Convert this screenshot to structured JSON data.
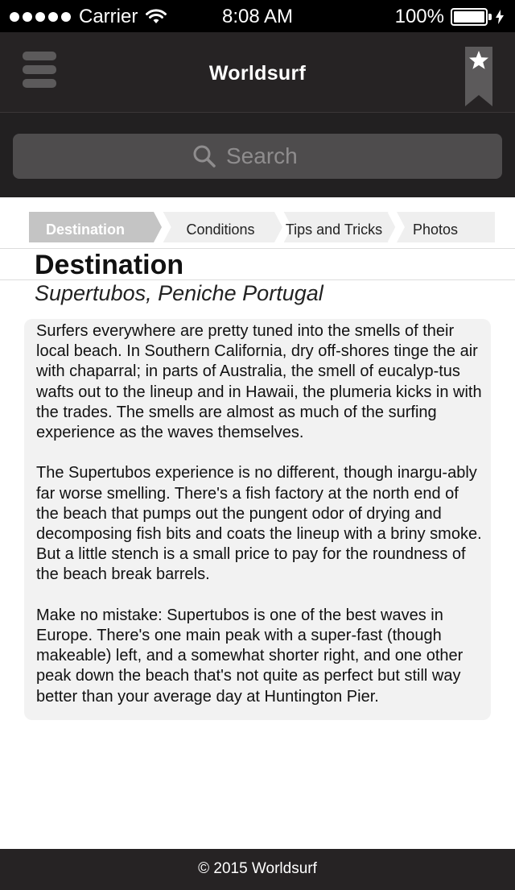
{
  "status_bar": {
    "carrier": "Carrier",
    "time": "8:08 AM",
    "battery": "100%",
    "signal_icon": "signal-dots-icon",
    "wifi_icon": "wifi-icon",
    "battery_icon": "battery-icon",
    "charging_icon": "charging-bolt-icon"
  },
  "header": {
    "title": "Worldsurf",
    "menu_icon": "hamburger-menu-icon",
    "bookmark_icon": "bookmark-star-icon"
  },
  "search": {
    "placeholder": "Search",
    "icon": "search-icon"
  },
  "tabs": [
    {
      "label": "Destination",
      "active": true
    },
    {
      "label": "Conditions",
      "active": false
    },
    {
      "label": "Tips and Tricks",
      "active": false
    },
    {
      "label": "Photos",
      "active": false
    }
  ],
  "content": {
    "title": "Destination",
    "subtitle": "Supertubos, Peniche Portugal",
    "paragraphs": [
      "Surfers everywhere are pretty tuned into the smells of their local beach. In Southern California, dry off-shores tinge the air with chaparral; in parts of Australia, the smell of eucalyp-tus wafts out to the lineup and in Hawaii, the plumeria kicks in with the trades. The smells are almost as much of the surfing experience as the waves themselves.",
      "The Supertubos experience is no different, though inargu-ably far worse smelling. There's a fish factory at the north end of the beach that pumps out the pungent odor of drying and decomposing fish bits and coats the lineup with a briny smoke. But a little stench is a small price to pay for the roundness of the beach break barrels.",
      "Make no mistake: Supertubos is one of the best waves in Europe. There's one main peak with a super-fast (though makeable) left, and a somewhat shorter right, and one other peak down the beach that's not quite as perfect but still way better than your average day at Huntington Pier."
    ]
  },
  "footer": {
    "text": "© 2015 Worldsurf"
  },
  "colors": {
    "header_bg": "#262324",
    "search_bg": "#4e4c4d",
    "tab_active_bg": "#c4c4c4",
    "tab_bg": "#efefef",
    "card_bg": "#f2f2f2"
  }
}
